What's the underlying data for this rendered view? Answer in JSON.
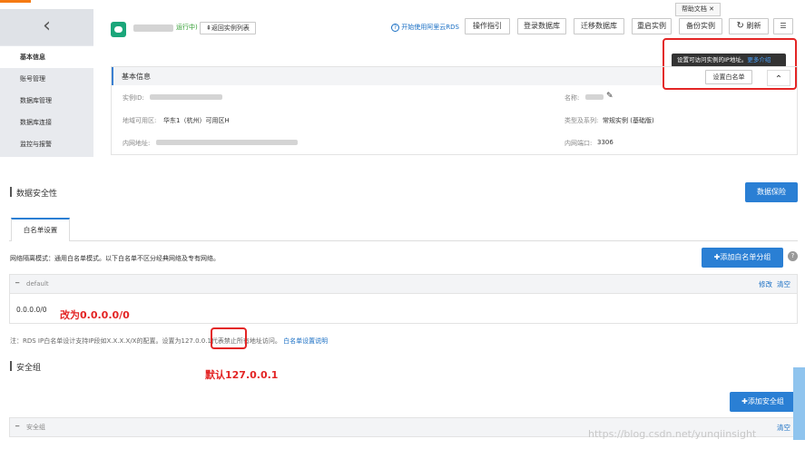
{
  "sidebar": {
    "back_glyph": "‹",
    "items": [
      "基本信息",
      "账号管理",
      "数据库管理",
      "数据库连接",
      "监控与报警"
    ]
  },
  "header": {
    "status": "运行中)",
    "back_link": "⇞返回实例列表",
    "help_docs": "帮助文档",
    "help_close": "✕",
    "start_link": "开始使用阿里云RDS",
    "buttons": [
      "操作指引",
      "登录数据库",
      "迁移数据库",
      "重启实例",
      "备份实例"
    ],
    "refresh": "刷新",
    "refresh_glyph": "↻",
    "menu_glyph": "☰"
  },
  "tooltip": {
    "text": "设置可访问实例的IP地址。",
    "link": "更多介绍",
    "button": "设置白名单",
    "collapse_glyph": "⌃"
  },
  "basic_info": {
    "title": "基本信息",
    "instance_id_label": "实例ID:",
    "name_label": "名称:",
    "zone_label": "地域可用区:",
    "zone_value": "华东1（杭州）可用区H",
    "type_label": "类型及系列:",
    "type_value": "常规实例 (基础版)",
    "intranet_label": "内网地址:",
    "port_label": "内网端口:",
    "port_value": "3306"
  },
  "security": {
    "title": "数据安全性",
    "protect_button": "数据保险",
    "tab": "白名单设置",
    "mode_text": "网络隔离模式：通用白名单模式。以下白名单不区分经典网络及专有网络。",
    "add_group_button": "✚添加白名单分组",
    "help_glyph": "?",
    "group_name": "default",
    "group_collapse": "━",
    "edit": "修改",
    "clear": "清空",
    "ip_value": "0.0.0.0/0",
    "annotation_change": "改为0.0.0.0/0",
    "note_prefix": "注：RDS IP白名单设计支持IP段如X.X.X.X/X的配置。设置为",
    "note_highlight": "127.0.0.1",
    "note_suffix": "代表禁止所有地址访问。",
    "note_link": "白名单设置说明",
    "annotation_default": "默认127.0.0.1"
  },
  "security_group": {
    "title": "安全组",
    "add_button": "✚添加安全组",
    "row_label": "安全组",
    "row_collapse": "━",
    "clear": "清空"
  },
  "watermark": "https://blog.csdn.net/yunqiinsight",
  "colors": {
    "accent": "#2a7fd4",
    "annotation": "#e32525",
    "sidebar_bg": "#e8eaee",
    "logo": "#1aa67a"
  }
}
